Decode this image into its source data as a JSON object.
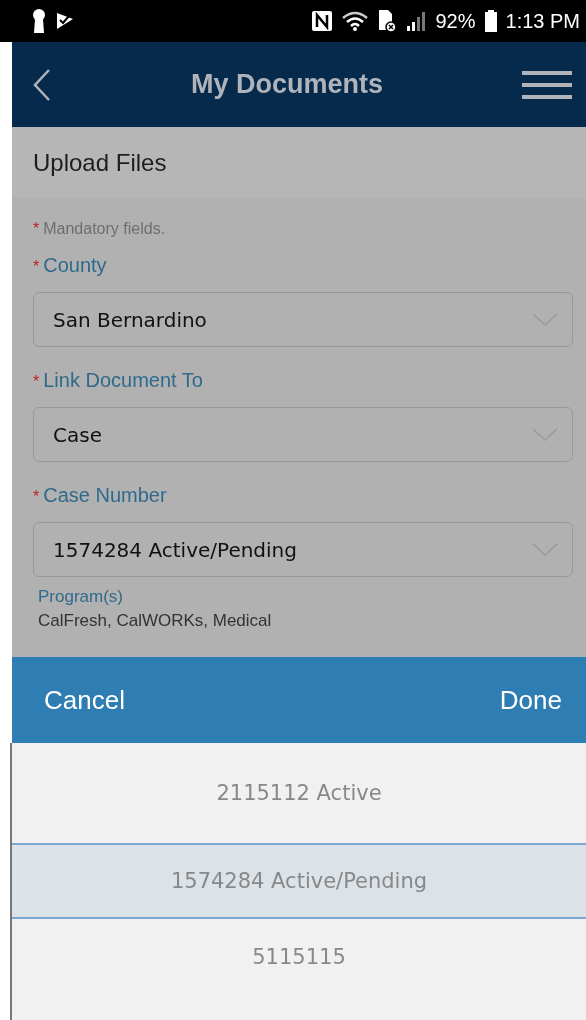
{
  "status_bar": {
    "battery": "92%",
    "time": "1:13 PM"
  },
  "header": {
    "title": "My Documents"
  },
  "section": {
    "title": "Upload Files"
  },
  "form": {
    "mandatory_mark": "*",
    "mandatory_note": "Mandatory fields.",
    "fields": [
      {
        "mark": "*",
        "label": "County",
        "value": "San Bernardino"
      },
      {
        "mark": "*",
        "label": "Link Document To",
        "value": "Case"
      },
      {
        "mark": "*",
        "label": "Case Number",
        "value": "1574284 Active/Pending"
      }
    ],
    "programs": {
      "label": "Program(s)",
      "value": "CalFresh, CalWORKs, Medical"
    }
  },
  "picker": {
    "cancel": "Cancel",
    "done": "Done",
    "options": [
      {
        "label": "2115112 Active",
        "selected": false
      },
      {
        "label": "1574284 Active/Pending",
        "selected": true
      },
      {
        "label": "5115115",
        "selected": false
      }
    ]
  }
}
